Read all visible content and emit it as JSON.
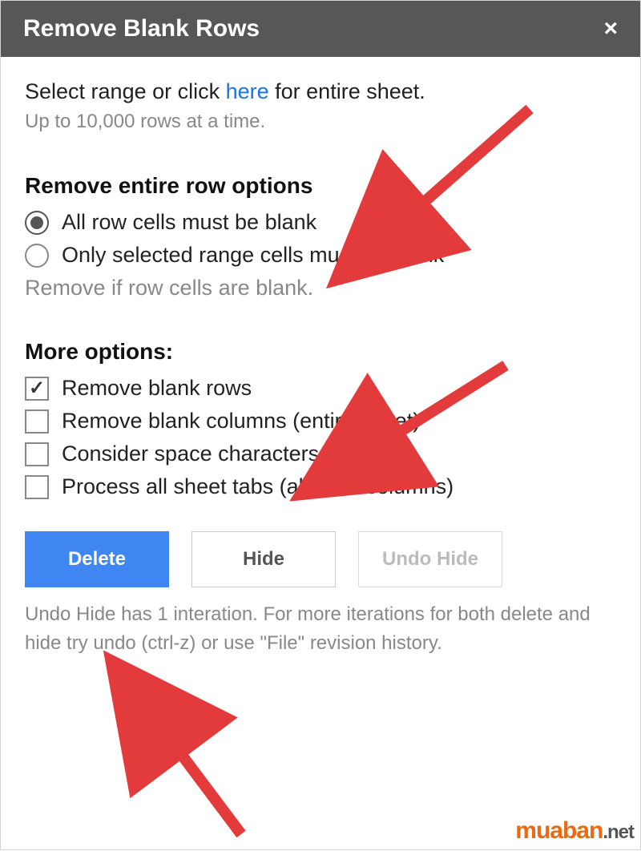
{
  "dialog": {
    "title": "Remove Blank Rows",
    "close_icon": "×",
    "range_prompt_before": "Select range or click ",
    "range_link": "here",
    "range_prompt_after": " for entire sheet.",
    "limit_hint": "Up to 10,000 rows at a time."
  },
  "row_options": {
    "heading": "Remove entire row options",
    "items": [
      {
        "label": "All row cells must be blank",
        "selected": true
      },
      {
        "label": "Only selected range cells must be blank",
        "selected": false
      }
    ],
    "description": "Remove if row cells are blank."
  },
  "more_options": {
    "heading": "More options:",
    "items": [
      {
        "label": "Remove blank rows",
        "checked": true
      },
      {
        "label": "Remove blank columns (entire sheet)",
        "checked": false
      },
      {
        "label": "Consider space characters as blanks",
        "checked": false
      },
      {
        "label": "Process all sheet tabs (all rows/columns)",
        "checked": false
      }
    ]
  },
  "buttons": {
    "delete": "Delete",
    "hide": "Hide",
    "undo_hide": "Undo Hide"
  },
  "foot_note": "Undo Hide has 1 interation. For more iterations for both delete and hide try undo (ctrl-z) or use \"File\" revision history.",
  "watermark": {
    "brand": "muaban",
    "suffix": ".net"
  },
  "colors": {
    "header_bg": "#575757",
    "link": "#1a73e8",
    "primary_btn": "#3f86f2",
    "arrow": "#e33b3b",
    "brand_orange": "#e96a10"
  }
}
